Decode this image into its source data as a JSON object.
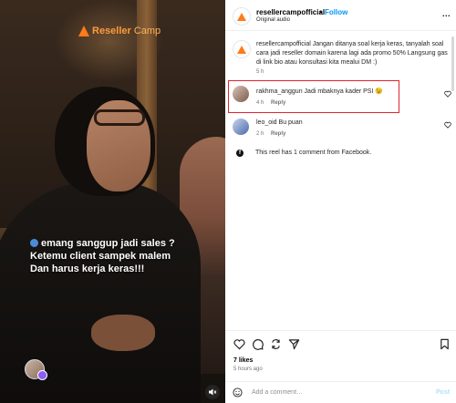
{
  "video": {
    "brand_name": "Reseller",
    "brand_suffix": "Camp",
    "caption_lines": [
      "emang sanggup jadi sales ?",
      "Ketemu client sampek malem",
      "Dan harus kerja keras!!!"
    ],
    "icons": [
      "brand-logo-icon",
      "speaker-muted-icon"
    ]
  },
  "header": {
    "username": "resellercampofficial",
    "separator": "•",
    "follow_label": "Follow",
    "audio_label": "Original audio",
    "more_label": "..."
  },
  "comments": [
    {
      "user": "resellercampofficial",
      "text": "Jangan ditanya soal kerja keras, tanyalah soal cara jadi reseller domain karena lagi ada promo 50% Langsung gas di link bio atau konsultasi kita mealui DM :)",
      "time": "5 h",
      "reply_label": ""
    },
    {
      "user": "rakhma_anggun",
      "text": "Jadi mbaknya kader PSI 😉",
      "time": "4 h",
      "reply_label": "Reply",
      "highlighted": true
    },
    {
      "user": "leo_oid",
      "text": "Bu puan",
      "time": "2 h",
      "reply_label": "Reply"
    }
  ],
  "facebook_note": "This reel has 1 comment from Facebook.",
  "actions": {
    "icons": [
      "heart-icon",
      "comment-icon",
      "share-icon",
      "send-icon",
      "bookmark-icon"
    ],
    "likes": "7 likes",
    "time_ago": "5 hours ago"
  },
  "add_comment": {
    "placeholder": "Add a comment…",
    "post_label": "Post"
  },
  "colors": {
    "follow": "#0095f6",
    "highlight_border": "#e0242f",
    "brand_orange": "#ff7a1a",
    "post_disabled": "#b2dffc"
  }
}
